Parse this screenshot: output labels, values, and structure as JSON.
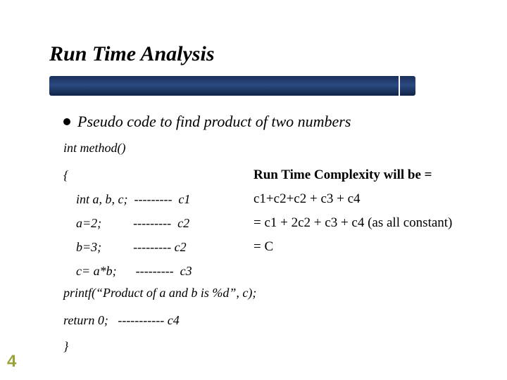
{
  "title": "Run Time Analysis",
  "bullet": "Pseudo code to find product of two numbers",
  "code": {
    "signature": "int method()",
    "open_brace": "{",
    "lines": [
      "int a, b, c;  ---------  c1",
      "a=2;          ---------  c2",
      "b=3;          --------- c2",
      "c= a*b;      ---------  c3"
    ],
    "printf": "printf(“Product of a and b is %d”, c);",
    "return": "return 0;   ----------- c4",
    "close_brace": "}"
  },
  "complexity": {
    "heading": "Run Time Complexity will be =",
    "lines": [
      "c1+c2+c2 + c3 + c4",
      "= c1 + 2c2 + c3 + c4  (as all constant)",
      "= C"
    ]
  },
  "page_number": "4"
}
